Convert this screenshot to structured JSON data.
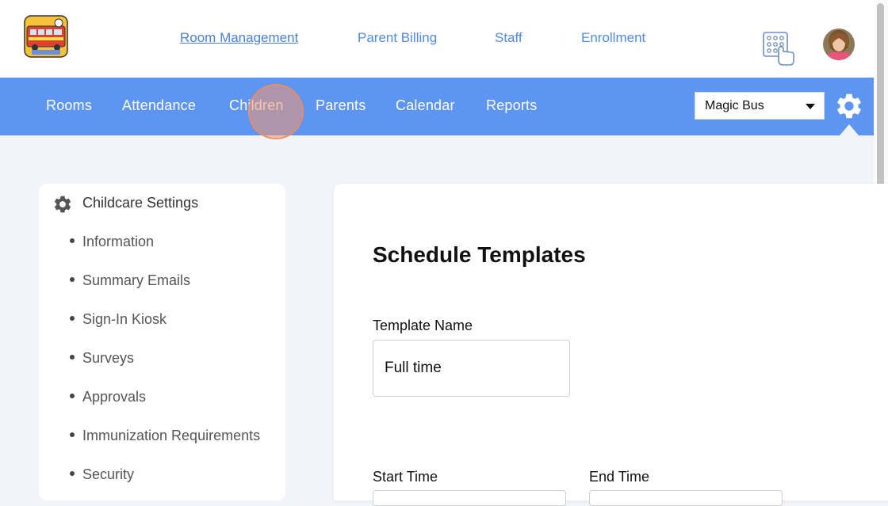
{
  "header": {
    "links": [
      {
        "label": "Room Management",
        "active": true
      },
      {
        "label": "Parent Billing",
        "active": false
      },
      {
        "label": "Staff",
        "active": false
      },
      {
        "label": "Enrollment",
        "active": false
      }
    ],
    "logo_icon": "magic-bus-logo",
    "kiosk_icon": "keypad-hand-icon",
    "avatar_icon": "user-avatar"
  },
  "nav": {
    "items": [
      "Rooms",
      "Attendance",
      "Children",
      "Parents",
      "Calendar",
      "Reports"
    ],
    "school_select": {
      "value": "Magic Bus"
    },
    "settings_icon": "gear-icon"
  },
  "sidebar": {
    "title": "Childcare Settings",
    "items": [
      "Information",
      "Summary Emails",
      "Sign-In Kiosk",
      "Surveys",
      "Approvals",
      "Immunization Requirements",
      "Security"
    ]
  },
  "main": {
    "heading": "Schedule Templates",
    "template_name_label": "Template Name",
    "template_name_value": "Full time",
    "start_time_label": "Start Time",
    "end_time_label": "End Time"
  },
  "colors": {
    "nav_blue": "#5e95f3",
    "link_blue": "#4f8ae6",
    "page_bg": "#f3f4f9",
    "click_highlight": "#f0966e"
  }
}
